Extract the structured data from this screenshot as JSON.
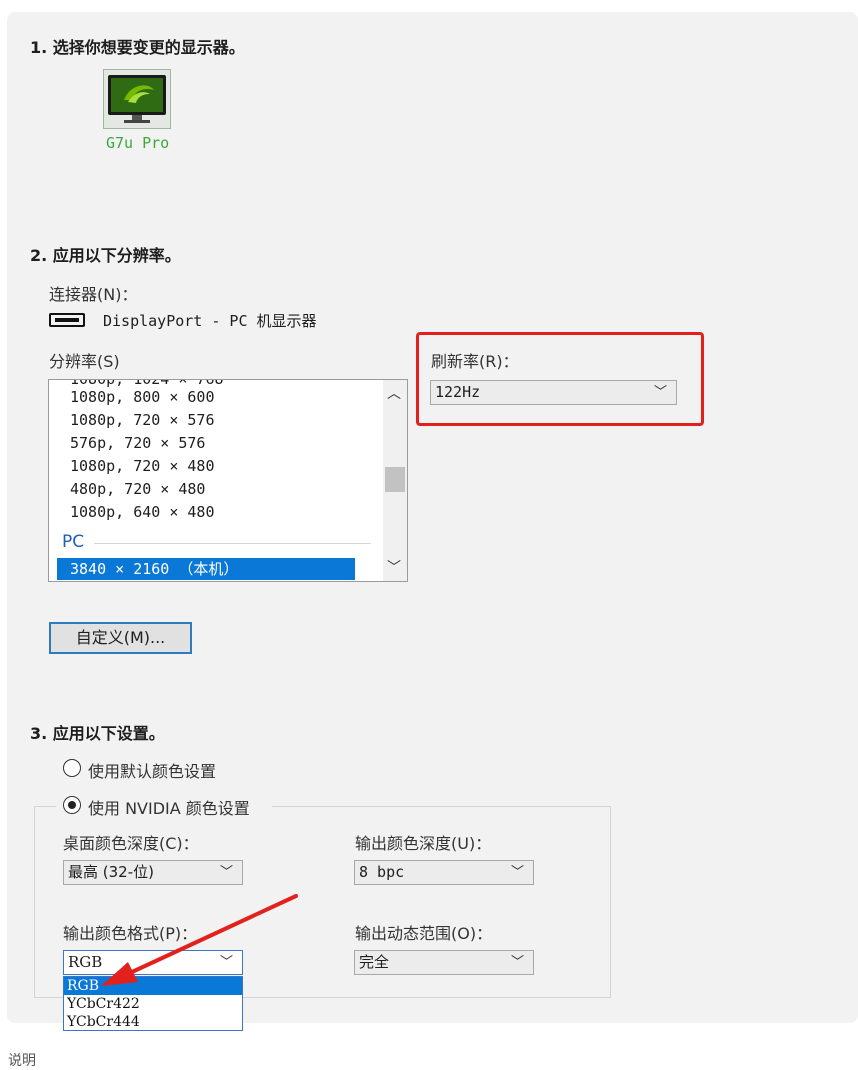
{
  "step1": {
    "title": "1.  选择你想要变更的显示器。",
    "monitor_name": "G7u Pro"
  },
  "step2": {
    "title": "2.  应用以下分辨率。",
    "connector_label": "连接器(N)：",
    "connector_value": "DisplayPort - PC 机显示器",
    "resolution_label": "分辨率(S)",
    "resolution_items": [
      "1080p, 800 × 600",
      "1080p, 720 × 576",
      "576p, 720 × 576",
      "1080p, 720 × 480",
      "480p, 720 × 480",
      "1080p, 640 × 480"
    ],
    "group_pc": "PC",
    "selected_resolution": "3840 × 2160 （本机）",
    "refresh_label": "刷新率(R)：",
    "refresh_value": "122Hz",
    "custom_button": "自定义(M)..."
  },
  "step3": {
    "title": "3.  应用以下设置。",
    "radio_default": "使用默认颜色设置",
    "radio_nvidia": "使用 NVIDIA 颜色设置",
    "desktop_depth_label": "桌面颜色深度(C)：",
    "desktop_depth_value": "最高 (32-位)",
    "output_depth_label": "输出颜色深度(U)：",
    "output_depth_value": "8 bpc",
    "output_format_label": "输出颜色格式(P)：",
    "output_format_value": "RGB",
    "output_format_options": [
      "RGB",
      "YCbCr422",
      "YCbCr444"
    ],
    "dynamic_range_label": "输出动态范围(O)：",
    "dynamic_range_value": "完全"
  },
  "footer_text": "说明",
  "colors": {
    "accent_blue": "#0a78d7",
    "highlight_red": "#e3211c",
    "nvidia_green": "#76b900"
  },
  "icons": [
    "monitor-icon",
    "displayport-icon",
    "chevron-down-icon",
    "chevron-up-icon"
  ]
}
